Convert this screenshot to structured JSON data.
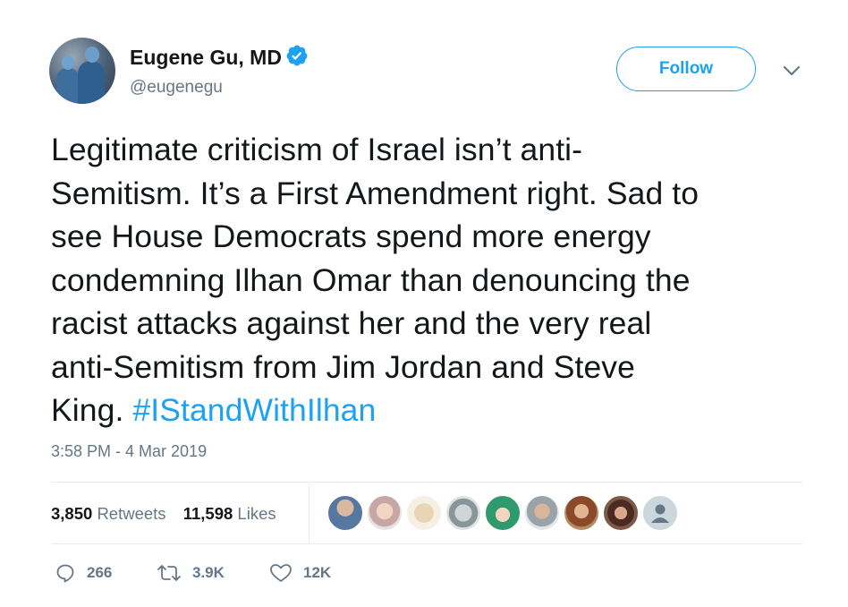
{
  "author": {
    "name": "Eugene Gu, MD",
    "handle": "@eugenegu",
    "verified_icon": "verified-badge-icon",
    "avatar_icon": "avatar"
  },
  "follow_button": {
    "label": "Follow"
  },
  "tweet": {
    "text_lines": [
      "Legitimate criticism of Israel isn’t anti-",
      "Semitism. It’s a First Amendment right. Sad to",
      "see House Democrats spend more energy",
      "condemning Ilhan Omar than denouncing the",
      "racist attacks against her and the very real",
      "anti-Semitism from Jim Jordan and Steve",
      "King. "
    ],
    "hashtag": "#IStandWithIlhan",
    "timestamp": "3:58 PM - 4 Mar 2019"
  },
  "stats": {
    "retweets_count": "3,850",
    "retweets_label": "Retweets",
    "likes_count": "11,598",
    "likes_label": "Likes"
  },
  "actions": {
    "reply_count": "266",
    "retweet_count": "3.9K",
    "like_count": "12K"
  },
  "colors": {
    "accent": "#1da1f2",
    "secondary_text": "#657786",
    "primary_text": "#14171a",
    "divider": "#e6ecf0"
  }
}
